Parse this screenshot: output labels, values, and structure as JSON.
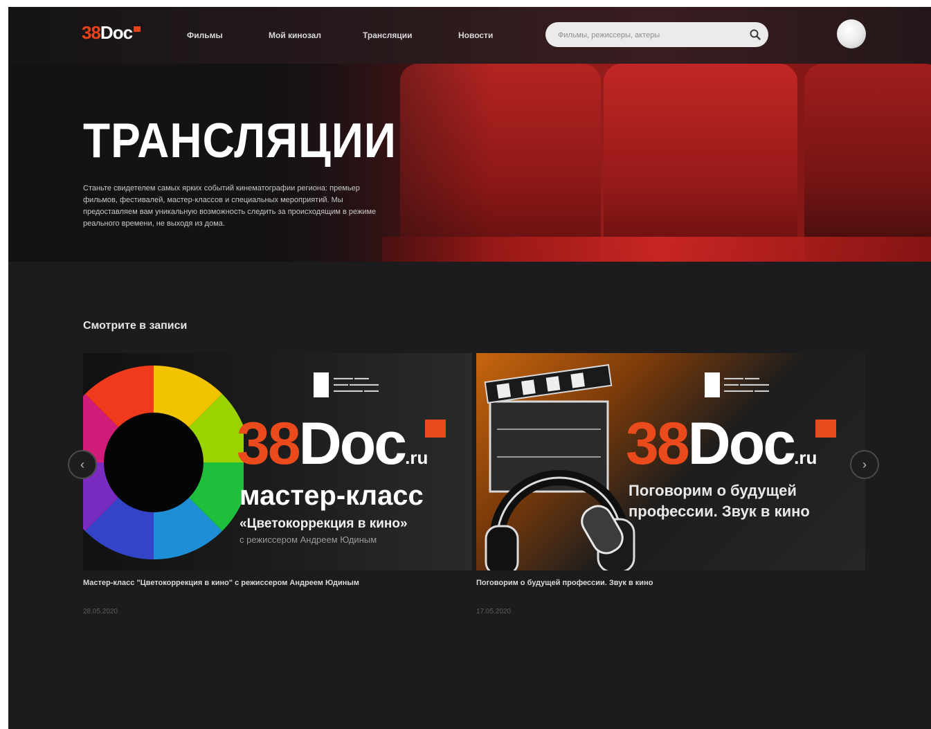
{
  "header": {
    "logo": {
      "number": "38",
      "word": "Doc"
    },
    "nav": [
      "Фильмы",
      "Мой кинозал",
      "Трансляции",
      "Новости"
    ],
    "search": {
      "placeholder": "Фильмы, режиссеры, актеры",
      "icon": "search-icon"
    },
    "avatar_icon": "avatar"
  },
  "hero": {
    "title": "ТРАНСЛЯЦИИ",
    "description": "Станьте свидетелем самых ярких событий кинематографии региона: премьер фильмов, фестивалей, мастер-классов и специальных мероприятий. Мы предоставляем вам уникальную возможность следить за происходящим в режиме реального времени, не выходя из дома."
  },
  "section": {
    "title": "Смотрите в записи",
    "prev_icon": "chevron-left-icon",
    "next_icon": "chevron-right-icon",
    "cards": [
      {
        "thumb_brand_number": "38",
        "thumb_brand_word": "Doc",
        "thumb_brand_suffix": ".ru",
        "thumb_heading": "мастер-класс",
        "thumb_subheading": "«Цветокоррекция в кино»",
        "thumb_caption": "с режиссером Андреем Юдиным",
        "title": "Мастер-класс \"Цветокоррекция в кино\" с режиссером Андреем Юдиным",
        "date": "28.05.2020"
      },
      {
        "thumb_brand_number": "38",
        "thumb_brand_word": "Doc",
        "thumb_brand_suffix": ".ru",
        "thumb_heading": "Поговорим о будущей",
        "thumb_subheading": "профессии. Звук в кино",
        "thumb_caption": "",
        "title": "Поговорим о будущей профессии. Звук в кино",
        "date": "17.05.2020"
      }
    ]
  },
  "colors": {
    "accent": "#ea4a1c",
    "background": "#1c1b1d",
    "hero_red": "#a3201e"
  }
}
